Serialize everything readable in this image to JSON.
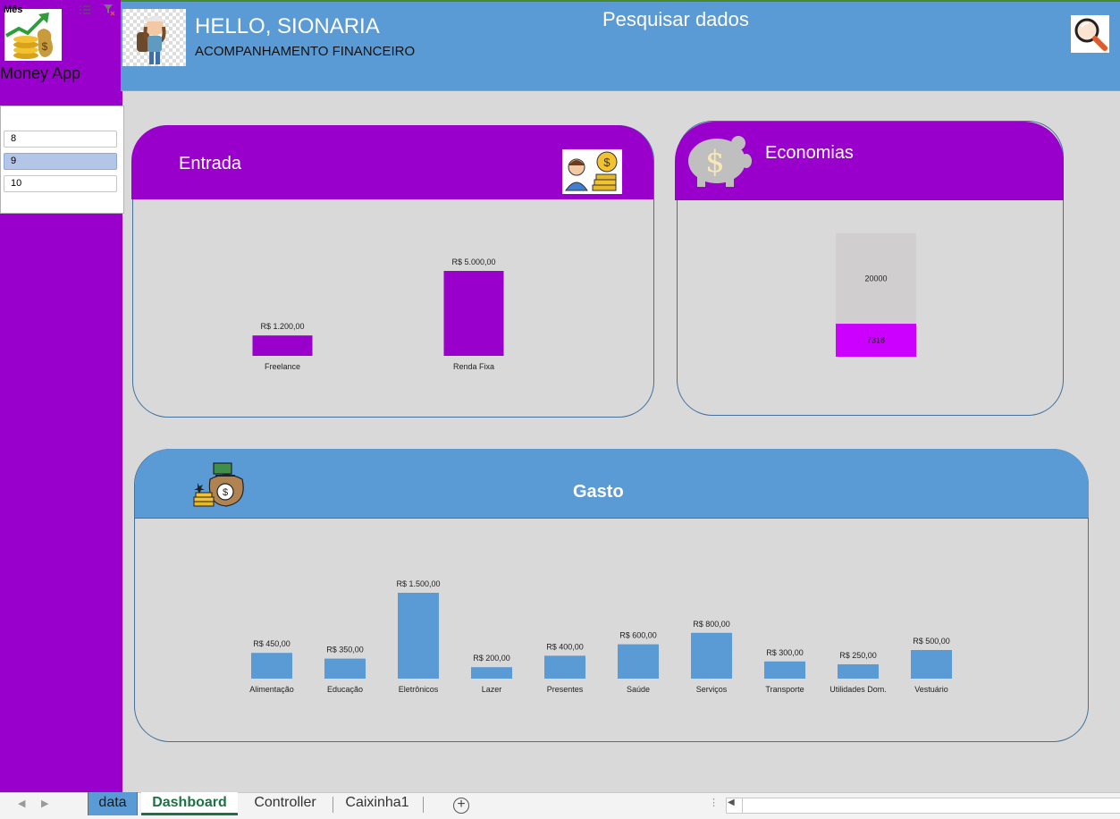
{
  "app": {
    "name": "Money App",
    "logo_icon": "money-growth-icon"
  },
  "header": {
    "greeting": "HELLO, SIONARIA",
    "subtitle": "ACOMPANHAMENTO FINANCEIRO",
    "search_label": "Pesquisar dados",
    "search_icon": "magnifier-icon",
    "background_color": "#5b9bd5"
  },
  "slicer": {
    "title": "Mês",
    "items": [
      {
        "label": "8",
        "selected": false
      },
      {
        "label": "9",
        "selected": true
      },
      {
        "label": "10",
        "selected": false
      }
    ]
  },
  "cards": {
    "entrada": {
      "title": "Entrada",
      "icon": "person-coins-icon",
      "accent": "#9900cc"
    },
    "economias": {
      "title": "Economias",
      "icon": "piggy-bank-icon",
      "accent": "#9900cc"
    },
    "gasto": {
      "title": "Gasto",
      "icon": "money-bag-icon",
      "accent": "#5b9bd5"
    }
  },
  "chart_data": [
    {
      "id": "entrada",
      "type": "bar",
      "categories": [
        "Freelance",
        "Renda Fixa"
      ],
      "values": [
        1200,
        5000
      ],
      "data_labels": [
        "R$ 1.200,00",
        "R$ 5.000,00"
      ],
      "ylim": [
        0,
        5500
      ],
      "color": "#9900cc",
      "grid": false
    },
    {
      "id": "economias",
      "type": "bar",
      "stacked": true,
      "segments": [
        {
          "value": 7318,
          "label": "7318",
          "color": "#cc00ff"
        },
        {
          "value": 20000,
          "label": "20000",
          "color": "#d0cece"
        }
      ],
      "grid": false
    },
    {
      "id": "gasto",
      "type": "bar",
      "categories": [
        "Alimentação",
        "Educação",
        "Eletrônicos",
        "Lazer",
        "Presentes",
        "Saúde",
        "Serviços",
        "Transporte",
        "Utilidades Dom.",
        "Vestuário"
      ],
      "values": [
        450,
        350,
        1500,
        200,
        400,
        600,
        800,
        300,
        250,
        500
      ],
      "data_labels": [
        "R$ 450,00",
        "R$ 350,00",
        "R$ 1.500,00",
        "R$ 200,00",
        "R$ 400,00",
        "R$ 600,00",
        "R$ 800,00",
        "R$ 300,00",
        "R$ 250,00",
        "R$ 500,00"
      ],
      "ylim": [
        0,
        1500
      ],
      "color": "#5b9bd5",
      "grid": false
    }
  ],
  "sheet_tabs": [
    {
      "label": "data",
      "active": false
    },
    {
      "label": "Dashboard",
      "active": true
    },
    {
      "label": "Controller",
      "active": false
    },
    {
      "label": "Caixinha1",
      "active": false
    }
  ],
  "tabbar": {
    "add_label": "+"
  }
}
